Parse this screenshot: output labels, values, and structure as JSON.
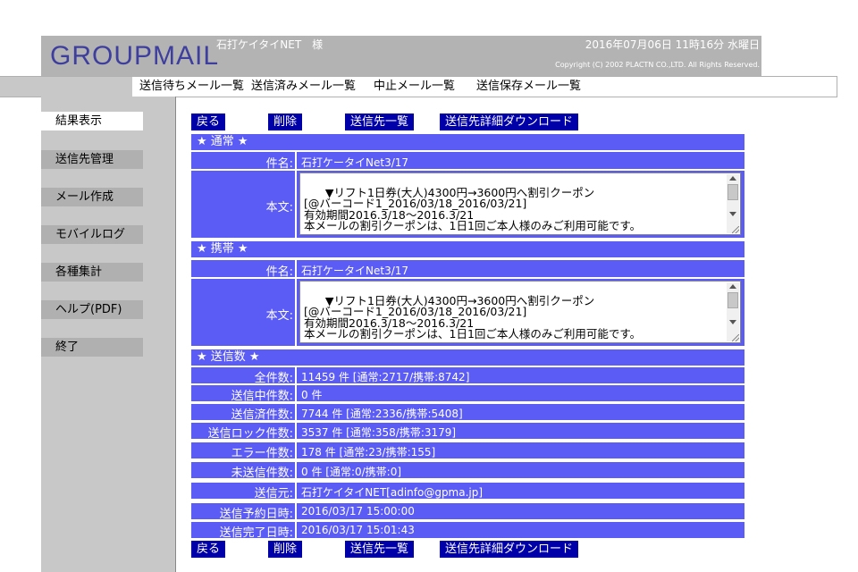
{
  "header": {
    "logo": "GROUPMAIL",
    "company": "石打ケイタイNET　様",
    "datetime": "2016年07月06日 11時16分 水曜日",
    "copyright": "Copyright (C) 2002 PLACTN CO.,LTD. All Rights Reserved."
  },
  "tabs": [
    "送信待ちメール一覧",
    "送信済みメール一覧",
    "中止メール一覧",
    "送信保存メール一覧"
  ],
  "sidebar": [
    "結果表示",
    "送信先管理",
    "メール作成",
    "モバイルログ",
    "各種集計",
    "ヘルプ(PDF)",
    "終了"
  ],
  "buttons": {
    "back": "戻る",
    "delete": "削除",
    "list": "送信先一覧",
    "download": "送信先詳細ダウンロード"
  },
  "normal": {
    "heading": "★ 通常 ★",
    "subject_label": "件名:",
    "subject": "石打ケータイNet3/17",
    "body_label": "本文:",
    "body": "▼リフト1日券(大人)4300円→3600円へ割引クーポン\n[@バーコード1_2016/03/18_2016/03/21]\n有効期間2016.3/18～2016.3/21\n本メールの割引クーポンは、1日1回ご本人様のみご利用可能です。"
  },
  "mobile": {
    "heading": "★ 携帯 ★",
    "subject_label": "件名:",
    "subject": "石打ケータイNet3/17",
    "body_label": "本文:",
    "body": "▼リフト1日券(大人)4300円→3600円へ割引クーポン\n[@バーコード1_2016/03/18_2016/03/21]\n有効期間2016.3/18～2016.3/21\n本メールの割引クーポンは、1日1回ご本人様のみご利用可能です。"
  },
  "counts": {
    "heading": "★ 送信数 ★",
    "rows": [
      {
        "label": "全件数:",
        "value": "11459 件 [通常:2717/携帯:8742]"
      },
      {
        "label": "送信中件数:",
        "value": "0 件"
      },
      {
        "label": "送信済件数:",
        "value": "7744 件 [通常:2336/携帯:5408]"
      },
      {
        "label": "送信ロック件数:",
        "value": "3537 件 [通常:358/携帯:3179]"
      },
      {
        "label": "エラー件数:",
        "value": "178 件 [通常:23/携帯:155]"
      },
      {
        "label": "未送信件数:",
        "value": "0 件 [通常:0/携帯:0]"
      }
    ]
  },
  "info": [
    {
      "label": "送信元:",
      "value": "石打ケイタイNET[adinfo@gpma.jp]"
    },
    {
      "label": "送信予約日時:",
      "value": "2016/03/17 15:00:00"
    },
    {
      "label": "送信完了日時:",
      "value": "2016/03/17 15:01:43"
    }
  ]
}
